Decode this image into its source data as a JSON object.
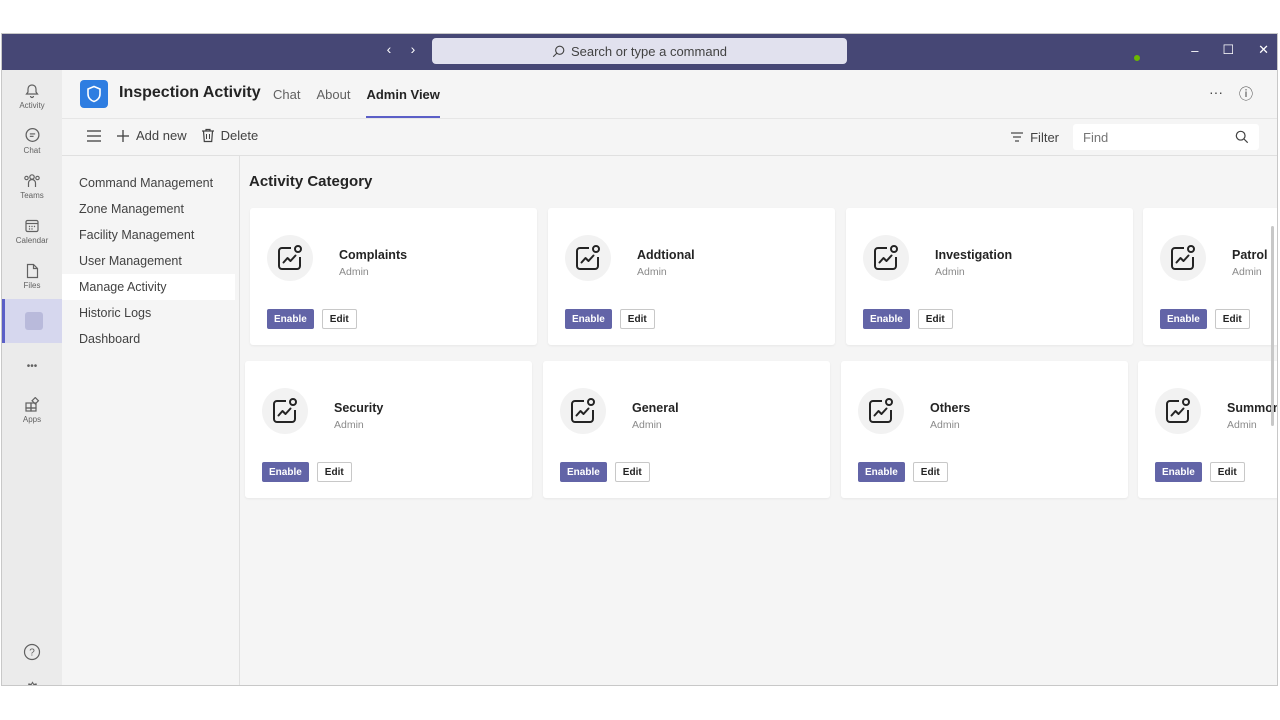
{
  "titlebar": {
    "back": "‹",
    "forward": "›",
    "search_placeholder": "Search or type a command",
    "minimize": "–",
    "maximize": "☐",
    "close": "✕"
  },
  "rail": {
    "activity": "Activity",
    "chat": "Chat",
    "teams": "Teams",
    "calendar": "Calendar",
    "files": "Files",
    "more": "•••",
    "apps": "Apps",
    "help": "?"
  },
  "header": {
    "app_title": "Inspection Activity",
    "tabs": [
      "Chat",
      "About",
      "Admin View"
    ],
    "more": "···",
    "info": "ⓘ"
  },
  "toolbar": {
    "add_new": "Add new",
    "delete": "Delete",
    "filter": "Filter",
    "find_placeholder": "Find"
  },
  "leftnav": {
    "items": [
      "Command Management",
      "Zone Management",
      "Facility Management",
      "User Management",
      "Manage Activity",
      "Historic Logs",
      "Dashboard"
    ],
    "active": "Manage Activity"
  },
  "content": {
    "title": "Activity Category",
    "cards": [
      {
        "name": "Complaints",
        "role": "Admin",
        "enable": "Enable",
        "edit": "Edit"
      },
      {
        "name": "Addtional",
        "role": "Admin",
        "enable": "Enable",
        "edit": "Edit"
      },
      {
        "name": "Investigation",
        "role": "Admin",
        "enable": "Enable",
        "edit": "Edit"
      },
      {
        "name": "Patrol",
        "role": "Admin",
        "enable": "Enable",
        "edit": "Edit"
      },
      {
        "name": "Security",
        "role": "Admin",
        "enable": "Enable",
        "edit": "Edit"
      },
      {
        "name": "General",
        "role": "Admin",
        "enable": "Enable",
        "edit": "Edit"
      },
      {
        "name": "Others",
        "role": "Admin",
        "enable": "Enable",
        "edit": "Edit"
      },
      {
        "name": "Summons",
        "role": "Admin",
        "enable": "Enable",
        "edit": "Edit"
      }
    ]
  },
  "colors": {
    "titlebar": "#464775",
    "accent": "#5b5fc7",
    "enable_button": "#6264a7",
    "app_logo": "#2e7de1",
    "presence": "#6bb700"
  }
}
